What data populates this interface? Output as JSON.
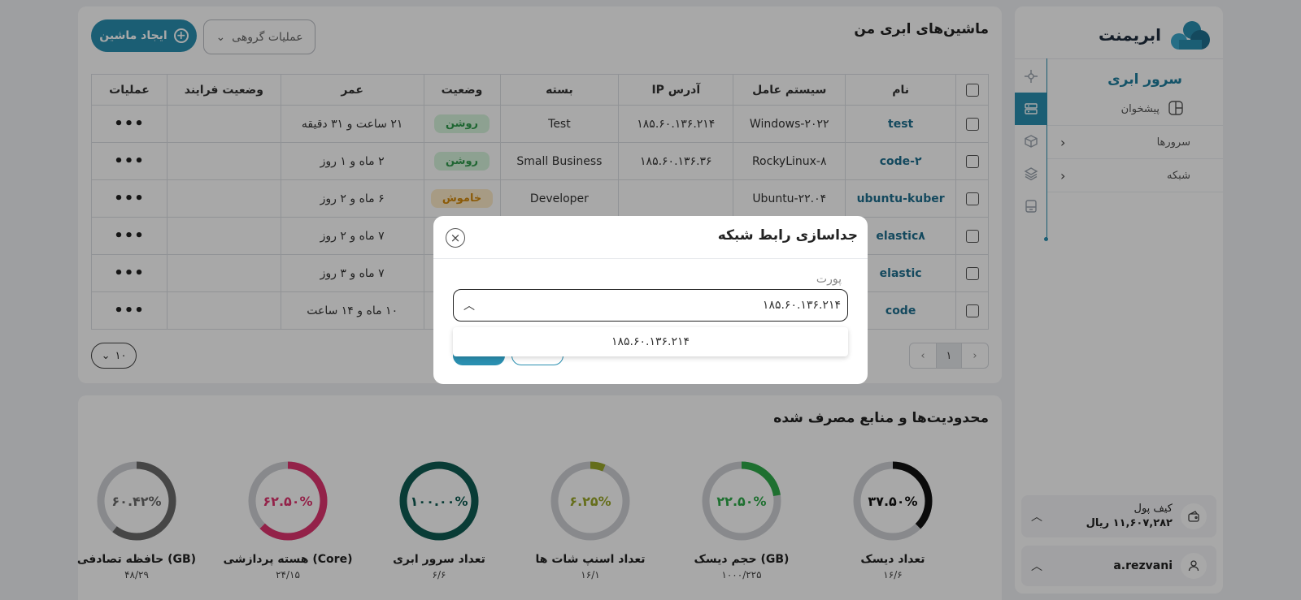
{
  "brand": {
    "name": "ابریمنت"
  },
  "sidebar": {
    "section_title": "سرور ابری",
    "home_label": "پیشخوان",
    "items": [
      {
        "label": "سرورها"
      },
      {
        "label": "شبکه"
      }
    ],
    "wallet": {
      "label": "کیف پول",
      "amount": "۱۱,۶۰۷,۲۸۲ ریال"
    },
    "user": {
      "name": "a.rezvani"
    }
  },
  "machines": {
    "title": "ماشین‌های ابری من",
    "create_button": "ایجاد ماشین",
    "bulk_button": "عملیات گروهی",
    "columns": [
      "نام",
      "سیستم عامل",
      "آدرس IP",
      "بسته",
      "وضعیت",
      "عمر",
      "وضعیت فرایند",
      "عملیات"
    ],
    "rows": [
      {
        "name": "test",
        "os": "Windows-۲۰۲۲",
        "ip": "۱۸۵.۶۰.۱۳۶.۲۱۴",
        "plan": "Test",
        "status": "روشن",
        "status_kind": "on",
        "age": "۲۱ ساعت و ۳۱ دقیقه",
        "process": ""
      },
      {
        "name": "code-۲",
        "os": "RockyLinux-۸",
        "ip": "۱۸۵.۶۰.۱۳۶.۳۶",
        "plan": "Small Business",
        "status": "روشن",
        "status_kind": "on",
        "age": "۲ ماه و ۱ روز",
        "process": ""
      },
      {
        "name": "ubuntu-kuber",
        "os": "Ubuntu-۲۲.۰۴",
        "ip": "",
        "plan": "Developer",
        "status": "خاموش",
        "status_kind": "off",
        "age": "۶ ماه و ۲ روز",
        "process": ""
      },
      {
        "name": "elastic۸",
        "os": "",
        "ip": "",
        "plan": "",
        "status": "",
        "status_kind": "",
        "age": "۷ ماه و ۲ روز",
        "process": ""
      },
      {
        "name": "elastic",
        "os": "",
        "ip": "",
        "plan": "",
        "status": "",
        "status_kind": "",
        "age": "۷ ماه و ۳ روز",
        "process": ""
      },
      {
        "name": "code",
        "os": "",
        "ip": "",
        "plan": "",
        "status": "",
        "status_kind": "",
        "age": "۱۰ ماه و ۱۴ ساعت",
        "process": ""
      }
    ],
    "pagination": {
      "current": "۱"
    },
    "per_page": "۱۰"
  },
  "resources": {
    "title": "محدودیت‌ها و منابع مصرف شده",
    "gauges": [
      {
        "label": "تعداد دیسک",
        "sub": "۱۶/۶",
        "percent_text": "۳۷.۵۰%",
        "fraction": 0.375,
        "color": "#111111"
      },
      {
        "label": "حجم دیسک (GB)",
        "sub": "۱۰۰۰/۲۲۵",
        "percent_text": "۲۲.۵۰%",
        "fraction": 0.225,
        "color": "#2eaa4a"
      },
      {
        "label": "تعداد اسنپ شات ها",
        "sub": "۱۶/۱",
        "percent_text": "۶.۲۵%",
        "fraction": 0.0625,
        "color": "#9aa72a"
      },
      {
        "label": "تعداد سرور ابری",
        "sub": "۶/۶",
        "percent_text": "۱۰۰.۰۰%",
        "fraction": 1.0,
        "color": "#0e5b53"
      },
      {
        "label": "هسته پردازشی (Core)",
        "sub": "۲۴/۱۵",
        "percent_text": "۶۲.۵۰%",
        "fraction": 0.625,
        "color": "#e0356f"
      },
      {
        "label": "حافظه تصادفی (GB)",
        "sub": "۴۸/۲۹",
        "percent_text": "۶۰.۴۲%",
        "fraction": 0.6042,
        "color": "#6b6b6b"
      }
    ]
  },
  "modal": {
    "title": "جداسازی رابط شبکه",
    "field_label": "پورت",
    "selected_value": "۱۸۵.۶۰.۱۳۶.۲۱۴",
    "options": [
      "۱۸۵.۶۰.۱۳۶.۲۱۴"
    ]
  },
  "colors": {
    "primary": "#2a8fb0",
    "on_badge": "#2f9b4c",
    "off_badge": "#d4890c"
  }
}
